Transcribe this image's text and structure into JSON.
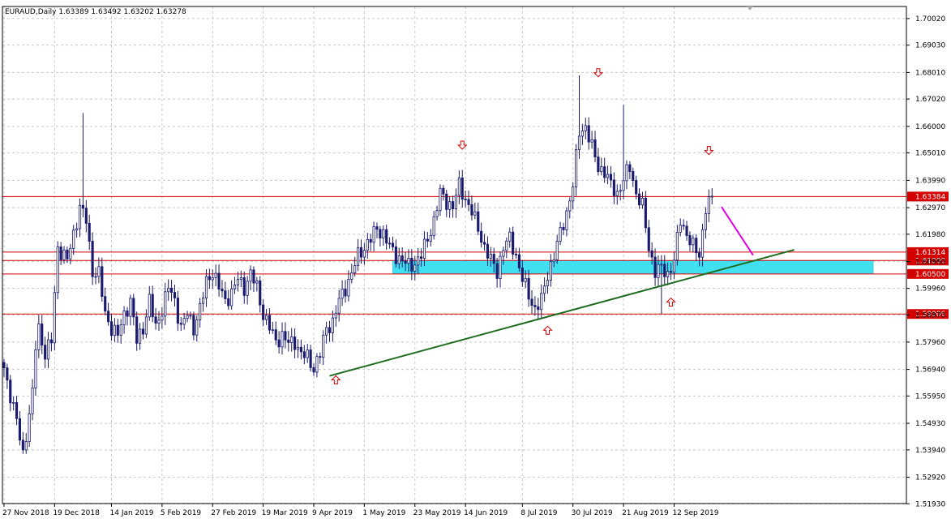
{
  "chart_data": {
    "type": "candlestick",
    "title": "EURAUD,Daily  1.63389 1.63492 1.63202 1.63278",
    "ylim": [
      1.5194,
      1.7047
    ],
    "grid": true,
    "y_ticks": [
      "1.70020",
      "1.69030",
      "1.68010",
      "1.67020",
      "1.66000",
      "1.65010",
      "1.63990",
      "1.62970",
      "1.61980",
      "1.60960",
      "1.59960",
      "1.58970",
      "1.57960",
      "1.56940",
      "1.55950",
      "1.54930",
      "1.53940",
      "1.52920",
      "1.51930"
    ],
    "x_ticks": [
      "27 Nov 2018",
      "19 Dec 2018",
      "14 Jan 2019",
      "5 Feb 2019",
      "27 Feb 2019",
      "19 Mar 2019",
      "9 Apr 2019",
      "1 May 2019",
      "23 May 2019",
      "14 Jun 2019",
      "8 Jul 2019",
      "30 Jul 2019",
      "21 Aug 2019",
      "12 Sep 2019"
    ],
    "x_tick_index": [
      0,
      16,
      34,
      50,
      66,
      82,
      98,
      114,
      130,
      146,
      164,
      180,
      196,
      212
    ],
    "close_anchors": [
      [
        0,
        1.57
      ],
      [
        4,
        1.55
      ],
      [
        6,
        1.538
      ],
      [
        9,
        1.56
      ],
      [
        10,
        1.578
      ],
      [
        11,
        1.585
      ],
      [
        13,
        1.575
      ],
      [
        15,
        1.58
      ],
      [
        17,
        1.615
      ],
      [
        20,
        1.61
      ],
      [
        22,
        1.62
      ],
      [
        24,
        1.63
      ],
      [
        26,
        1.625
      ],
      [
        28,
        1.606
      ],
      [
        30,
        1.605
      ],
      [
        32,
        1.59
      ],
      [
        34,
        1.585
      ],
      [
        36,
        1.582
      ],
      [
        38,
        1.59
      ],
      [
        40,
        1.595
      ],
      [
        42,
        1.58
      ],
      [
        44,
        1.585
      ],
      [
        46,
        1.595
      ],
      [
        48,
        1.585
      ],
      [
        50,
        1.592
      ],
      [
        52,
        1.6
      ],
      [
        54,
        1.595
      ],
      [
        56,
        1.585
      ],
      [
        58,
        1.59
      ],
      [
        60,
        1.585
      ],
      [
        62,
        1.592
      ],
      [
        64,
        1.602
      ],
      [
        66,
        1.606
      ],
      [
        68,
        1.6
      ],
      [
        70,
        1.595
      ],
      [
        72,
        1.598
      ],
      [
        74,
        1.603
      ],
      [
        76,
        1.6
      ],
      [
        78,
        1.605
      ],
      [
        80,
        1.6
      ],
      [
        82,
        1.59
      ],
      [
        84,
        1.585
      ],
      [
        86,
        1.58
      ],
      [
        88,
        1.582
      ],
      [
        90,
        1.579
      ],
      [
        92,
        1.58
      ],
      [
        94,
        1.575
      ],
      [
        96,
        1.574
      ],
      [
        98,
        1.57
      ],
      [
        100,
        1.575
      ],
      [
        102,
        1.585
      ],
      [
        104,
        1.587
      ],
      [
        106,
        1.595
      ],
      [
        108,
        1.6
      ],
      [
        110,
        1.605
      ],
      [
        112,
        1.612
      ],
      [
        114,
        1.615
      ],
      [
        116,
        1.618
      ],
      [
        118,
        1.622
      ],
      [
        120,
        1.62
      ],
      [
        122,
        1.615
      ],
      [
        124,
        1.612
      ],
      [
        126,
        1.61
      ],
      [
        128,
        1.608
      ],
      [
        130,
        1.609
      ],
      [
        132,
        1.612
      ],
      [
        134,
        1.618
      ],
      [
        136,
        1.625
      ],
      [
        138,
        1.635
      ],
      [
        140,
        1.632
      ],
      [
        142,
        1.63
      ],
      [
        144,
        1.638
      ],
      [
        146,
        1.633
      ],
      [
        148,
        1.628
      ],
      [
        150,
        1.622
      ],
      [
        152,
        1.615
      ],
      [
        154,
        1.61
      ],
      [
        156,
        1.606
      ],
      [
        158,
        1.615
      ],
      [
        160,
        1.618
      ],
      [
        162,
        1.612
      ],
      [
        164,
        1.603
      ],
      [
        166,
        1.597
      ],
      [
        168,
        1.592
      ],
      [
        170,
        1.595
      ],
      [
        172,
        1.605
      ],
      [
        174,
        1.612
      ],
      [
        176,
        1.62
      ],
      [
        178,
        1.628
      ],
      [
        180,
        1.638
      ],
      [
        182,
        1.658
      ],
      [
        184,
        1.66
      ],
      [
        186,
        1.652
      ],
      [
        188,
        1.645
      ],
      [
        190,
        1.643
      ],
      [
        192,
        1.638
      ],
      [
        194,
        1.635
      ],
      [
        196,
        1.64
      ],
      [
        198,
        1.645
      ],
      [
        200,
        1.635
      ],
      [
        202,
        1.63
      ],
      [
        204,
        1.615
      ],
      [
        206,
        1.606
      ],
      [
        208,
        1.607
      ],
      [
        210,
        1.605
      ],
      [
        212,
        1.61
      ],
      [
        214,
        1.625
      ],
      [
        216,
        1.62
      ],
      [
        218,
        1.615
      ],
      [
        220,
        1.612
      ],
      [
        222,
        1.63
      ],
      [
        224,
        1.6328
      ]
    ],
    "spikes": [
      {
        "index": 25,
        "high": 1.665
      },
      {
        "index": 182,
        "high": 1.679
      },
      {
        "index": 196,
        "high": 1.668
      },
      {
        "index": 208,
        "low": 1.59
      }
    ],
    "h_lines": [
      {
        "value": 1.63384,
        "label": "1.63384"
      },
      {
        "value": 1.61314,
        "label": "1.61314"
      },
      {
        "value": 1.61,
        "label": "1.61000"
      },
      {
        "value": 1.605,
        "label": "1.60500"
      },
      {
        "value": 1.59006,
        "label": "1.59006"
      }
    ],
    "zone": {
      "from_index": 123,
      "to_index": 275,
      "low": 1.605,
      "high": 1.61,
      "color": "#40E0F0"
    },
    "trendlines": [
      {
        "x1": 103,
        "y1": 1.567,
        "x2": 250,
        "y2": 1.614,
        "color": "#1F6B1F"
      },
      {
        "x1": 227,
        "y1": 1.63,
        "x2": 237,
        "y2": 1.612,
        "color": "#E000E0"
      }
    ],
    "arrows_down": [
      {
        "index": 188,
        "value": 1.68
      },
      {
        "index": 145,
        "value": 1.653
      },
      {
        "index": 223,
        "value": 1.651
      }
    ],
    "arrows_up": [
      {
        "index": 105,
        "value": 1.5655
      },
      {
        "index": 172,
        "value": 1.584
      },
      {
        "index": 211,
        "value": 1.5945
      }
    ],
    "colors": {
      "bull": "#ffffff",
      "bear": "#1a1a6e",
      "candle_line": "#1a1a6e",
      "grid": "#c8c8c8",
      "hline": "#d40000",
      "arrow": "#d40000",
      "axis": "#000000"
    }
  }
}
